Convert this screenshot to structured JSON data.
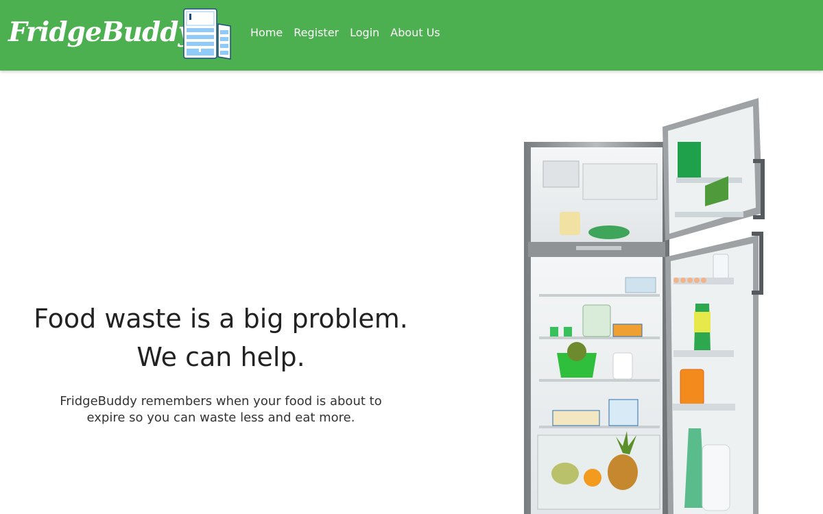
{
  "navbar": {
    "brand": "FridgeBuddy",
    "links": [
      {
        "label": "Home"
      },
      {
        "label": "Register"
      },
      {
        "label": "Login"
      },
      {
        "label": "About Us"
      }
    ]
  },
  "hero": {
    "headline_line1": "Food waste is a big problem.",
    "headline_line2": "We can help.",
    "subtext": "FridgeBuddy remembers when your food is about to expire so you can waste less and eat more."
  },
  "colors": {
    "nav_background": "#4caf50",
    "nav_text": "#ffffff",
    "logo_icon": "#90caf9"
  },
  "icons": {
    "logo": "fridge-icon",
    "hero_image": "open-fridge-image"
  }
}
